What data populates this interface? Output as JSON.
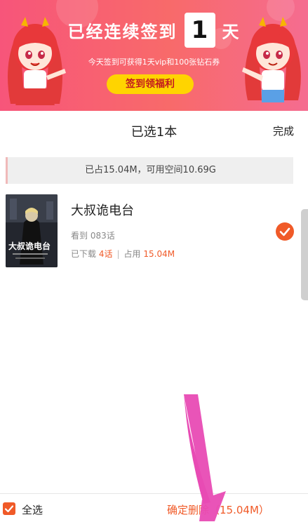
{
  "banner": {
    "title_prefix": "已经连续签到",
    "days": "1",
    "title_suffix": "天",
    "subtitle": "今天签到可获得1天vip和100张钻石券",
    "button": "签到领福利"
  },
  "header": {
    "title": "已选1本",
    "done": "完成"
  },
  "storage": {
    "text": "已占15.04M，可用空间10.69G"
  },
  "item": {
    "title": "大叔诡电台",
    "watched": "看到 083话",
    "downloaded_label": "已下载",
    "downloaded_count": "4话",
    "separator": "|",
    "used_label": "占用",
    "used_size": "15.04M",
    "selected": true,
    "cover_text": "大叔诡电台"
  },
  "bottom": {
    "select_all": "全选",
    "delete": "确定删除（15.04M）"
  },
  "colors": {
    "accent": "#f05a28",
    "banner_pink": "#f7557a",
    "banner_button": "#ffd400",
    "annotation_arrow": "#e84bb4"
  }
}
